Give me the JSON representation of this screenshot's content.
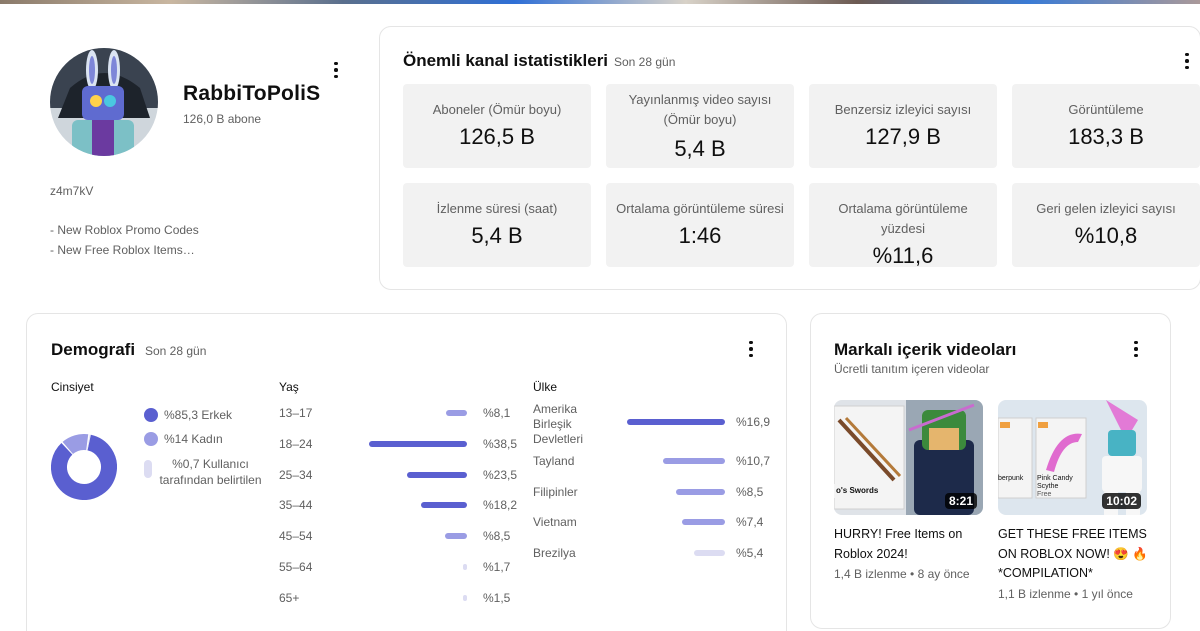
{
  "profile": {
    "name": "RabbiToPoliS",
    "subscribers": "126,0 B abone",
    "desc_code": "z4m7kV",
    "desc_line1": "- New Roblox Promo Codes",
    "desc_line2": "- New Free Roblox Items…"
  },
  "stats": {
    "title": "Önemli kanal istatistikleri",
    "period": "Son 28 gün",
    "tiles": [
      {
        "label": "Aboneler (Ömür boyu)",
        "value": "126,5 B"
      },
      {
        "label": "Yayınlanmış video sayısı (Ömür boyu)",
        "value": "5,4 B"
      },
      {
        "label": "Benzersiz izleyici sayısı",
        "value": "127,9 B"
      },
      {
        "label": "Görüntüleme",
        "value": "183,3 B"
      },
      {
        "label": "İzlenme süresi (saat)",
        "value": "5,4 B"
      },
      {
        "label": "Ortalama görüntüleme süresi",
        "value": "1:46"
      },
      {
        "label": "Ortalama görüntüleme yüzdesi",
        "value": "%11,6"
      },
      {
        "label": "Geri gelen izleyici sayısı",
        "value": "%10,8"
      }
    ]
  },
  "demographics": {
    "title": "Demografi",
    "period": "Son 28 gün",
    "gender": {
      "heading": "Cinsiyet",
      "items": [
        {
          "label": "%85,3 Erkek",
          "value": 85.3,
          "color": "#5a5fd0"
        },
        {
          "label": "%14 Kadın",
          "value": 14,
          "color": "#9a9ce4"
        },
        {
          "label": "%0,7 Kullanıcı tarafından belirtilen",
          "value": 0.7,
          "color": "#dcdcf2"
        }
      ]
    },
    "age": {
      "heading": "Yaş",
      "rows": [
        {
          "label": "13–17",
          "pct": "%8,1",
          "value": 8.1
        },
        {
          "label": "18–24",
          "pct": "%38,5",
          "value": 38.5
        },
        {
          "label": "25–34",
          "pct": "%23,5",
          "value": 23.5
        },
        {
          "label": "35–44",
          "pct": "%18,2",
          "value": 18.2
        },
        {
          "label": "45–54",
          "pct": "%8,5",
          "value": 8.5
        },
        {
          "label": "55–64",
          "pct": "%1,7",
          "value": 1.7
        },
        {
          "label": "65+",
          "pct": "%1,5",
          "value": 1.5
        }
      ]
    },
    "country": {
      "heading": "Ülke",
      "rows": [
        {
          "label": "Amerika Birleşik Devletleri",
          "pct": "%16,9",
          "value": 16.9
        },
        {
          "label": "Tayland",
          "pct": "%10,7",
          "value": 10.7
        },
        {
          "label": "Filipinler",
          "pct": "%8,5",
          "value": 8.5
        },
        {
          "label": "Vietnam",
          "pct": "%7,4",
          "value": 7.4
        },
        {
          "label": "Brezilya",
          "pct": "%5,4",
          "value": 5.4
        }
      ]
    }
  },
  "branded": {
    "title": "Markalı içerik videoları",
    "subtitle": "Ücretli tanıtım içeren videolar",
    "videos": [
      {
        "title": "HURRY! Free Items on Roblox 2024!",
        "meta": "1,4 B izlenme • 8 ay önce",
        "duration": "8:21",
        "thumb_text": "o's Swords"
      },
      {
        "title": "GET THESE FREE ITEMS ON ROBLOX NOW! 😍 🔥 *COMPILATION*",
        "meta": "1,1 B izlenme • 1 yıl önce",
        "duration": "10:02",
        "thumb_text_1": "berpunk",
        "thumb_text_2": "Pink Candy Scythe",
        "thumb_text_3": "Free"
      }
    ]
  }
}
